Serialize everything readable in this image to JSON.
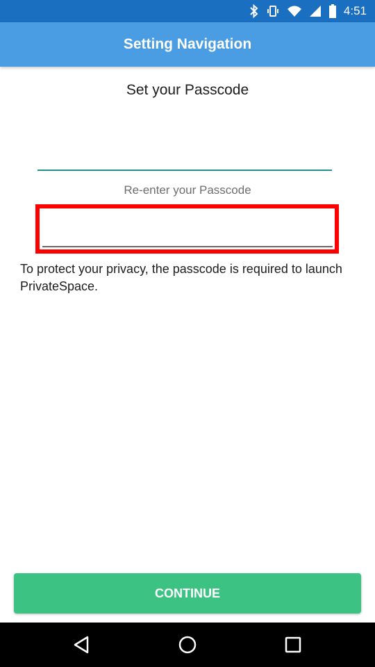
{
  "status_bar": {
    "time": "4:51",
    "background": "#1a6fc0"
  },
  "app_bar": {
    "title": "Setting Navigation",
    "background": "#4a9de3"
  },
  "form": {
    "passcode_label": "Set your Passcode",
    "passcode_value": "",
    "reenter_label": "Re-enter your Passcode",
    "reenter_value": "",
    "privacy_text": "To protect your privacy, the passcode is required to launch PrivateSpace."
  },
  "continue_button": {
    "label": "CONTINUE",
    "background": "#3cc384"
  },
  "highlight_color": "#ff0000",
  "nav_bar": {
    "icons": [
      "back-icon",
      "home-icon",
      "recents-icon"
    ]
  }
}
